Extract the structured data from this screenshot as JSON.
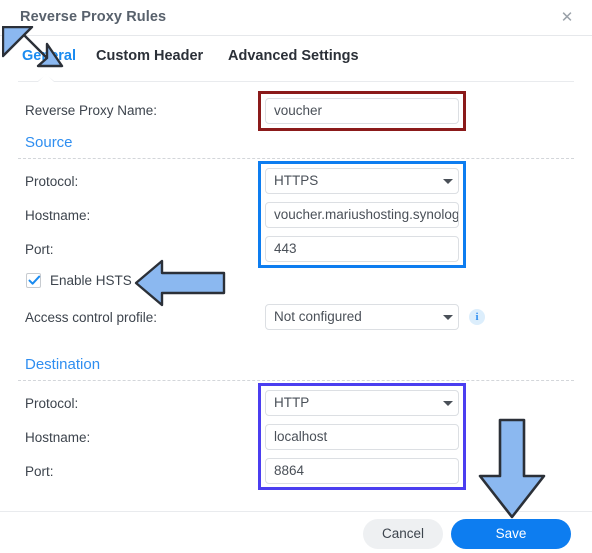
{
  "window": {
    "title": "Reverse Proxy Rules",
    "close_icon": "close-icon"
  },
  "tabs": [
    {
      "label": "General",
      "active": true
    },
    {
      "label": "Custom Header",
      "active": false
    },
    {
      "label": "Advanced Settings",
      "active": false
    }
  ],
  "form": {
    "name_label": "Reverse Proxy Name:",
    "name_value": "voucher",
    "source": {
      "heading": "Source",
      "protocol_label": "Protocol:",
      "protocol_value": "HTTPS",
      "hostname_label": "Hostname:",
      "hostname_value": "voucher.mariushosting.synology.me",
      "port_label": "Port:",
      "port_value": "443"
    },
    "hsts": {
      "label": "Enable HSTS",
      "checked": true
    },
    "access_control": {
      "label": "Access control profile:",
      "value": "Not configured",
      "info_icon": "info-icon"
    },
    "destination": {
      "heading": "Destination",
      "protocol_label": "Protocol:",
      "protocol_value": "HTTP",
      "hostname_label": "Hostname:",
      "hostname_value": "localhost",
      "port_label": "Port:",
      "port_value": "8864"
    }
  },
  "footer": {
    "cancel_label": "Cancel",
    "save_label": "Save"
  },
  "annotations": {
    "arrow_tab": "arrow-down-right-icon",
    "arrow_hsts": "arrow-left-icon",
    "arrow_save": "arrow-down-icon",
    "highlight_name_color": "#8b1a1a",
    "highlight_source_color": "#0d7df0",
    "highlight_destination_color": "#4b3ef0"
  }
}
